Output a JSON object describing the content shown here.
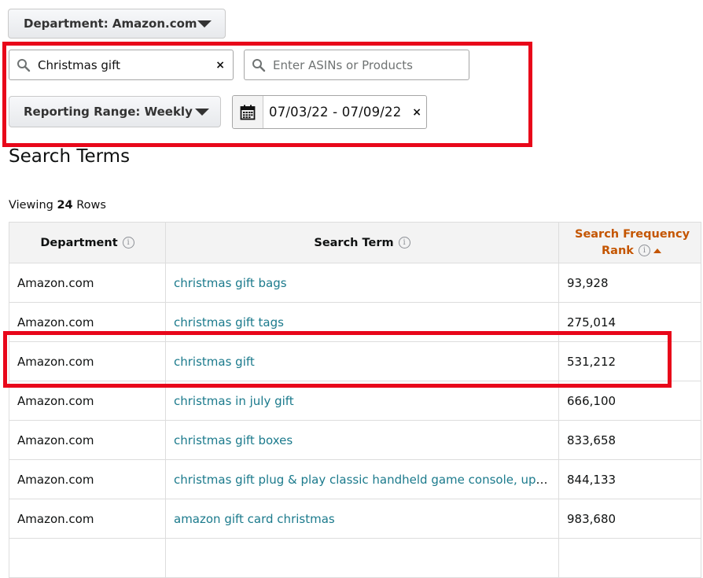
{
  "filters": {
    "department_label": "Department: Amazon.com",
    "search_value": "Christmas gift",
    "asin_placeholder": "Enter ASINs or Products",
    "reporting_range_label": "Reporting Range: Weekly",
    "date_range": "07/03/22  -  07/09/22",
    "clear_symbol": "×"
  },
  "page": {
    "title": "Search Terms",
    "viewing_prefix": "Viewing ",
    "row_count": "24",
    "viewing_suffix": " Rows"
  },
  "table": {
    "columns": {
      "department": "Department",
      "search_term": "Search Term",
      "rank_line1": "Search Frequency",
      "rank_line2": "Rank"
    },
    "info_symbol": "i",
    "rows": [
      {
        "department": "Amazon.com",
        "term": "christmas gift bags",
        "rank": "93,928"
      },
      {
        "department": "Amazon.com",
        "term": "christmas gift tags",
        "rank": "275,014"
      },
      {
        "department": "Amazon.com",
        "term": "christmas gift",
        "rank": "531,212"
      },
      {
        "department": "Amazon.com",
        "term": "christmas in july gift",
        "rank": "666,100"
      },
      {
        "department": "Amazon.com",
        "term": "christmas gift boxes",
        "rank": "833,658"
      },
      {
        "department": "Amazon.com",
        "term": "christmas gift plug & play classic handheld game console, upgraded",
        "rank": "844,133"
      },
      {
        "department": "Amazon.com",
        "term": "amazon gift card christmas",
        "rank": "983,680"
      },
      {
        "department": "",
        "term": "",
        "rank": ""
      }
    ]
  },
  "colors": {
    "highlight": "#e8071a",
    "sorted_header": "#c45500",
    "link": "#1b7a8c"
  }
}
